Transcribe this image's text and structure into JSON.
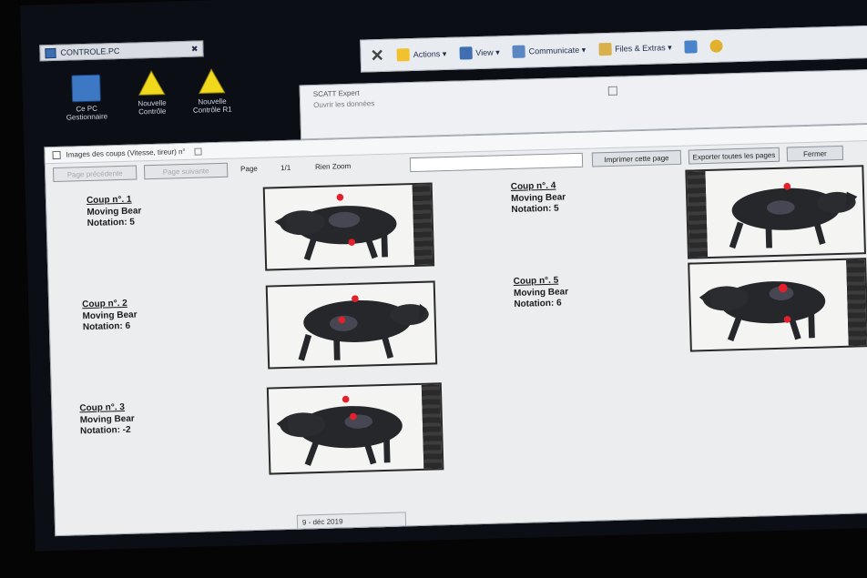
{
  "taskbar": {
    "tab_label": "CONTROLE.PC",
    "pin": "✖"
  },
  "desktop": {
    "icons": [
      {
        "label": "Ce PC\nGestionnaire",
        "icon": "computer-icon"
      },
      {
        "label": "Nouvelle\nContrôle",
        "icon": "warning-triangle-icon"
      },
      {
        "label": "Nouvelle\nContrôle R1",
        "icon": "warning-triangle-icon"
      }
    ]
  },
  "toolbar": {
    "actions_label": "Actions ▾",
    "view_label": "View ▾",
    "communicate_label": "Communicate ▾",
    "files_label": "Files & Extras ▾"
  },
  "back_window": {
    "title": "SCATT Expert",
    "subtitle": "Ouvrir les données"
  },
  "dialog": {
    "title": "Images des coups (Vitesse, tireur) n°",
    "button_prev": "Page précédente",
    "button_next": "Page suivante",
    "page_label": "Page",
    "page_value": "1/1",
    "zoom_label": "Rien Zoom",
    "button_print": "Imprimer cette page",
    "button_save": "Exporter toutes les pages",
    "button_close": "Fermer",
    "footer_date": "9 - déc 2019"
  },
  "shots": [
    {
      "coup": "Coup n°. 1",
      "target": "Moving Bear",
      "notation": "Notation: 5"
    },
    {
      "coup": "Coup n°. 2",
      "target": "Moving Bear",
      "notation": "Notation: 6"
    },
    {
      "coup": "Coup n°. 3",
      "target": "Moving Bear",
      "notation": "Notation: -2"
    },
    {
      "coup": "Coup n°. 4",
      "target": "Moving Bear",
      "notation": "Notation: 5"
    },
    {
      "coup": "Coup n°. 5",
      "target": "Moving Bear",
      "notation": "Notation: 6"
    }
  ],
  "colors": {
    "hit": "#e3202b",
    "animal": "#26272b",
    "screen_bg": "#ecedef"
  }
}
